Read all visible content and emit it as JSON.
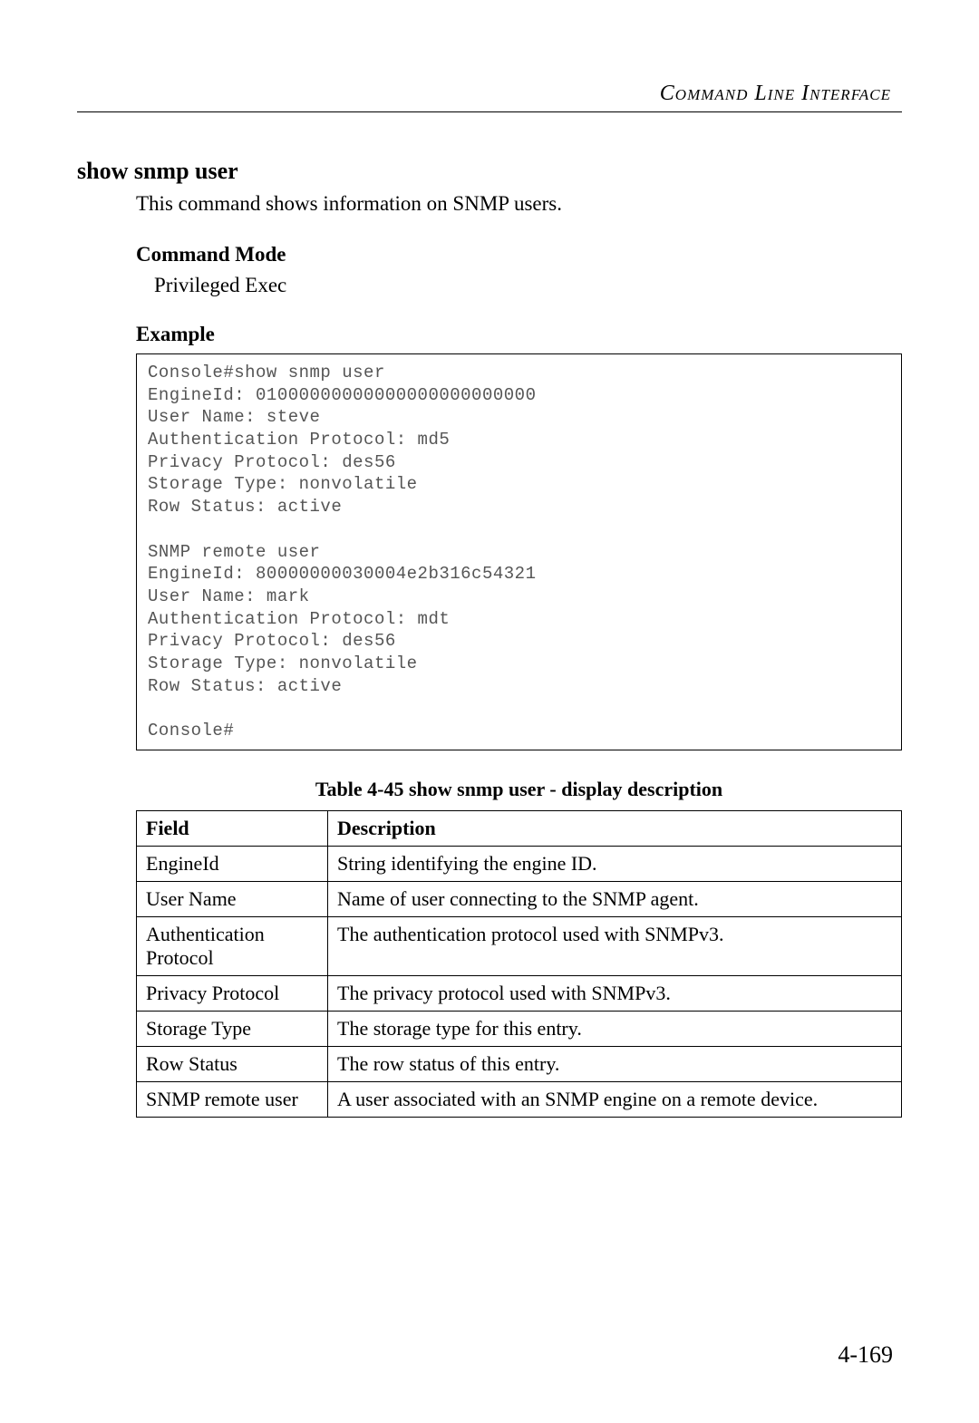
{
  "header": {
    "running_head": "Command Line Interface"
  },
  "command": {
    "title": "show snmp user",
    "intro": "This command shows information on SNMP users.",
    "mode_heading": "Command Mode",
    "mode_value": "Privileged Exec",
    "example_heading": "Example"
  },
  "console_output": "Console#show snmp user\nEngineId: 01000000000000000000000000\nUser Name: steve\nAuthentication Protocol: md5\nPrivacy Protocol: des56\nStorage Type: nonvolatile\nRow Status: active\n\nSNMP remote user\nEngineId: 80000000030004e2b316c54321\nUser Name: mark\nAuthentication Protocol: mdt\nPrivacy Protocol: des56\nStorage Type: nonvolatile\nRow Status: active\n\nConsole#",
  "table": {
    "caption": "Table 4-45   show snmp user - display description",
    "headers": {
      "field": "Field",
      "description": "Description"
    },
    "rows": [
      {
        "field": "EngineId",
        "description": "String identifying the engine ID."
      },
      {
        "field": "User Name",
        "description": "Name of user connecting to the SNMP agent."
      },
      {
        "field": "Authentication Protocol",
        "description": "The authentication protocol used with SNMPv3."
      },
      {
        "field": "Privacy Protocol",
        "description": "The privacy protocol used with SNMPv3."
      },
      {
        "field": "Storage Type",
        "description": "The storage type for this entry."
      },
      {
        "field": "Row Status",
        "description": "The row status of this entry."
      },
      {
        "field": "SNMP remote user",
        "description": "A user associated with an SNMP engine on a remote device."
      }
    ]
  },
  "page_number": "4-169"
}
